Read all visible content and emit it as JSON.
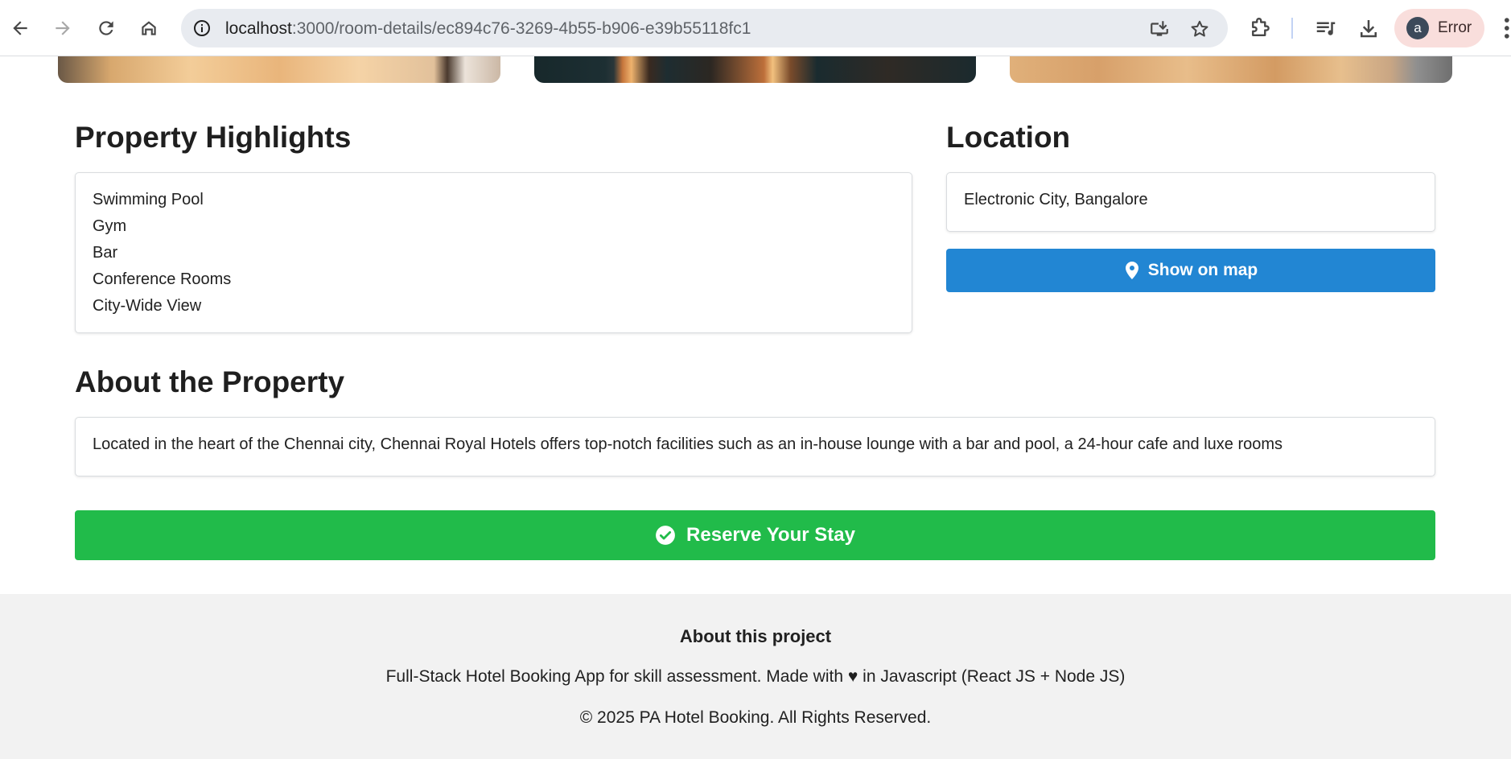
{
  "browser": {
    "url_host": "localhost",
    "url_path": ":3000/room-details/ec894c76-3269-4b55-b906-e39b55118fc1",
    "profile_initial": "a",
    "profile_status": "Error"
  },
  "highlights": {
    "title": "Property Highlights",
    "items": [
      "Swimming Pool",
      "Gym",
      "Bar",
      "Conference Rooms",
      "City-Wide View"
    ]
  },
  "location": {
    "title": "Location",
    "address": "Electronic City, Bangalore",
    "map_button_label": "Show on map"
  },
  "about": {
    "title": "About the Property",
    "description": "Located in the heart of the Chennai city, Chennai Royal Hotels offers top-notch facilities such as an in-house lounge with a bar and pool, a 24-hour cafe and luxe rooms"
  },
  "reserve": {
    "label": "Reserve Your Stay"
  },
  "footer": {
    "title": "About this project",
    "desc_before": "Full-Stack Hotel Booking App for skill assessment. Made with",
    "heart": "♥",
    "desc_after": "in Javascript (React JS + Node JS)",
    "copyright": "© 2025 PA Hotel Booking. All Rights Reserved."
  },
  "colors": {
    "map_button": "#2286d3",
    "reserve_button": "#21bb4a",
    "footer_bg": "#f2f2f2"
  },
  "icons": {
    "back": "arrow-left-icon",
    "forward": "arrow-right-icon",
    "reload": "reload-icon",
    "home": "home-icon",
    "site_info": "info-icon",
    "install": "install-app-icon",
    "bookmark": "star-icon",
    "extensions": "puzzle-icon",
    "reading_list": "playlist-icon",
    "downloads": "download-icon",
    "map_button": "map-pin-icon",
    "reserve_button": "check-circle-icon"
  }
}
